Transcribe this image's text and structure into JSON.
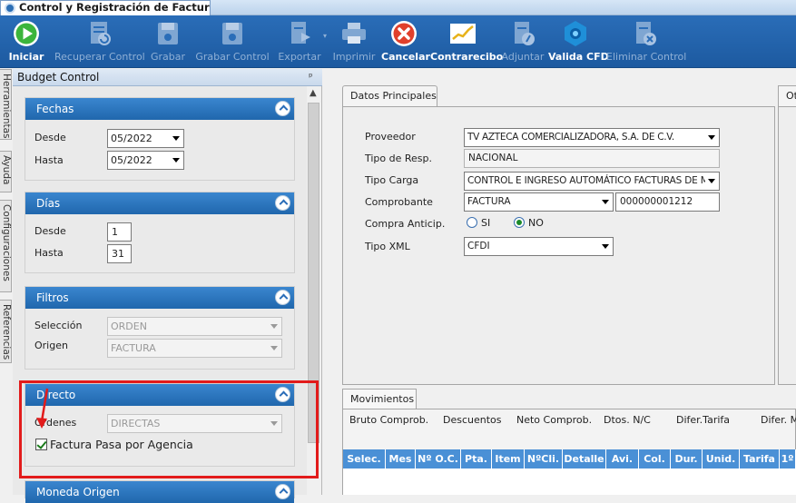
{
  "window": {
    "title": "Control y Registración de Factura..."
  },
  "toolbar": {
    "buttons": [
      {
        "label": "Iniciar",
        "icon": "play-icon",
        "enabled": true
      },
      {
        "label": "Recuperar Control",
        "icon": "recover-doc-icon",
        "enabled": false
      },
      {
        "label": "Grabar",
        "icon": "save-disk-icon",
        "enabled": false
      },
      {
        "label": "Grabar Control",
        "icon": "save-control-icon",
        "enabled": false
      },
      {
        "label": "Exportar",
        "icon": "export-doc-icon",
        "enabled": false
      },
      {
        "label": "Imprimir",
        "icon": "printer-icon",
        "enabled": false
      },
      {
        "label": "Cancelar",
        "icon": "cancel-x-icon",
        "enabled": true
      },
      {
        "label": "Contrarecibo",
        "icon": "chart-receipt-icon",
        "enabled": true
      },
      {
        "label": "Adjuntar",
        "icon": "attach-doc-icon",
        "enabled": false
      },
      {
        "label": "Valida CFD",
        "icon": "validate-cfd-icon",
        "enabled": true
      },
      {
        "label": "Eliminar Control",
        "icon": "delete-doc-icon",
        "enabled": false
      }
    ]
  },
  "sidetabs": [
    "Herramientas",
    "Ayuda",
    "Configuraciones",
    "Referencias"
  ],
  "left_panel": {
    "title": "Budget Control",
    "fechas": {
      "header": "Fechas",
      "desde_label": "Desde",
      "desde_value": "05/2022",
      "hasta_label": "Hasta",
      "hasta_value": "05/2022"
    },
    "dias": {
      "header": "Días",
      "desde_label": "Desde",
      "desde_value": "1",
      "hasta_label": "Hasta",
      "hasta_value": "31"
    },
    "filtros": {
      "header": "Filtros",
      "seleccion_label": "Selección",
      "seleccion_value": "ORDEN",
      "origen_label": "Origen",
      "origen_value": "FACTURA"
    },
    "directo": {
      "header": "Directo",
      "ordenes_label": "Ordenes",
      "ordenes_value": "DIRECTAS",
      "checkbox_label": "Factura Pasa por Agencia",
      "checkbox_checked": true
    },
    "moneda": {
      "header": "Moneda Origen"
    }
  },
  "datos_principales": {
    "tab": "Datos Principales",
    "proveedor_label": "Proveedor",
    "proveedor_value": "TV AZTECA COMERCIALIZADORA, S.A. DE C.V.",
    "tipo_resp_label": "Tipo de Resp.",
    "tipo_resp_value": "NACIONAL",
    "tipo_carga_label": "Tipo Carga",
    "tipo_carga_value": "CONTROL E INGRESO AUTOMÁTICO FACTURAS DE MED",
    "comprobante_label": "Comprobante",
    "comprobante_value": "FACTURA",
    "comprobante_num": "000000001212",
    "compra_label": "Compra Anticip.",
    "si_label": "SI",
    "no_label": "NO",
    "tipo_xml_label": "Tipo XML",
    "tipo_xml_value": "CFDI"
  },
  "other_tab": "Ot",
  "movimientos": {
    "tab": "Movimientos",
    "totals": [
      "Bruto Comprob.",
      "Descuentos",
      "Neto Comprob.",
      "Dtos. N/C",
      "Difer.Tarifa",
      "Difer. M"
    ],
    "columns": [
      "Selec.",
      "Mes",
      "Nº O.C.",
      "Pta.",
      "Item",
      "NºCli.",
      "Detalle",
      "Avi.",
      "Col.",
      "Dur.",
      "Unid.",
      "Tarifa",
      "1º"
    ]
  },
  "colors": {
    "toolbar_bg": "#2067ad",
    "group_header": "#2f7cc4",
    "grid_header": "#4a90d6",
    "highlight": "#e21b1b"
  }
}
